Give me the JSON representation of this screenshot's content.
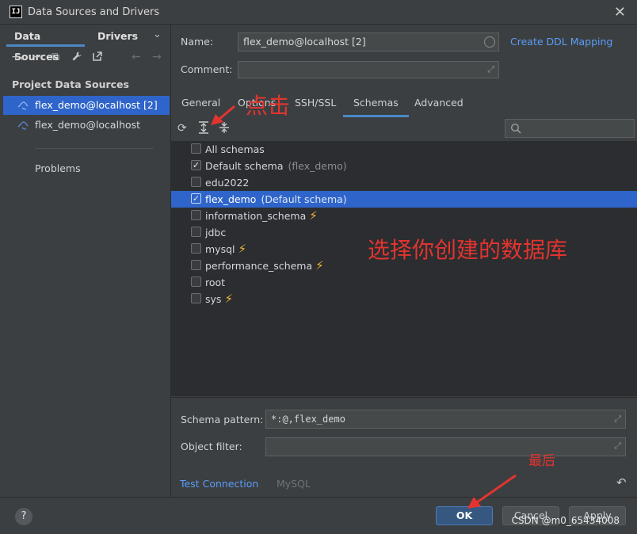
{
  "window": {
    "title": "Data Sources and Drivers",
    "logo_text": "IJ"
  },
  "left": {
    "tabs": [
      "Data Sources",
      "Drivers"
    ],
    "section_title": "Project Data Sources",
    "items": [
      "flex_demo@localhost [2]",
      "flex_demo@localhost"
    ],
    "problems_label": "Problems"
  },
  "form": {
    "name_label": "Name:",
    "name_value": "flex_demo@localhost [2]",
    "comment_label": "Comment:",
    "comment_value": "",
    "ddl_link": "Create DDL Mapping"
  },
  "tabs": [
    "General",
    "Options",
    "SSH/SSL",
    "Schemas",
    "Advanced"
  ],
  "active_tab": "Schemas",
  "schemas": [
    {
      "name": "All schemas",
      "hint": "",
      "checked": false,
      "selected": false,
      "bolt": false
    },
    {
      "name": "Default schema",
      "hint": "(flex_demo)",
      "checked": true,
      "selected": false,
      "bolt": false
    },
    {
      "name": "edu2022",
      "hint": "",
      "checked": false,
      "selected": false,
      "bolt": false
    },
    {
      "name": "flex_demo",
      "hint": "(Default schema)",
      "checked": true,
      "selected": true,
      "bolt": false
    },
    {
      "name": "information_schema",
      "hint": "",
      "checked": false,
      "selected": false,
      "bolt": true
    },
    {
      "name": "jdbc",
      "hint": "",
      "checked": false,
      "selected": false,
      "bolt": false
    },
    {
      "name": "mysql",
      "hint": "",
      "checked": false,
      "selected": false,
      "bolt": true
    },
    {
      "name": "performance_schema",
      "hint": "",
      "checked": false,
      "selected": false,
      "bolt": true
    },
    {
      "name": "root",
      "hint": "",
      "checked": false,
      "selected": false,
      "bolt": false
    },
    {
      "name": "sys",
      "hint": "",
      "checked": false,
      "selected": false,
      "bolt": true
    }
  ],
  "bottom": {
    "schema_pattern_label": "Schema pattern:",
    "schema_pattern_value": "*:@,flex_demo",
    "object_filter_label": "Object filter:",
    "object_filter_value": "",
    "test_connection": "Test Connection",
    "driver_name": "MySQL"
  },
  "footer": {
    "help": "?",
    "ok": "OK",
    "cancel": "Cancel",
    "apply": "Apply"
  },
  "annotations": {
    "click": "点击",
    "choose_db": "选择你创建的数据库",
    "finally": "最后"
  },
  "watermark": "CSDN @m0_65434008",
  "colors": {
    "accent": "#2f65ca",
    "link": "#589df6",
    "annotation": "#e2342f",
    "bolt": "#f2b43a"
  }
}
